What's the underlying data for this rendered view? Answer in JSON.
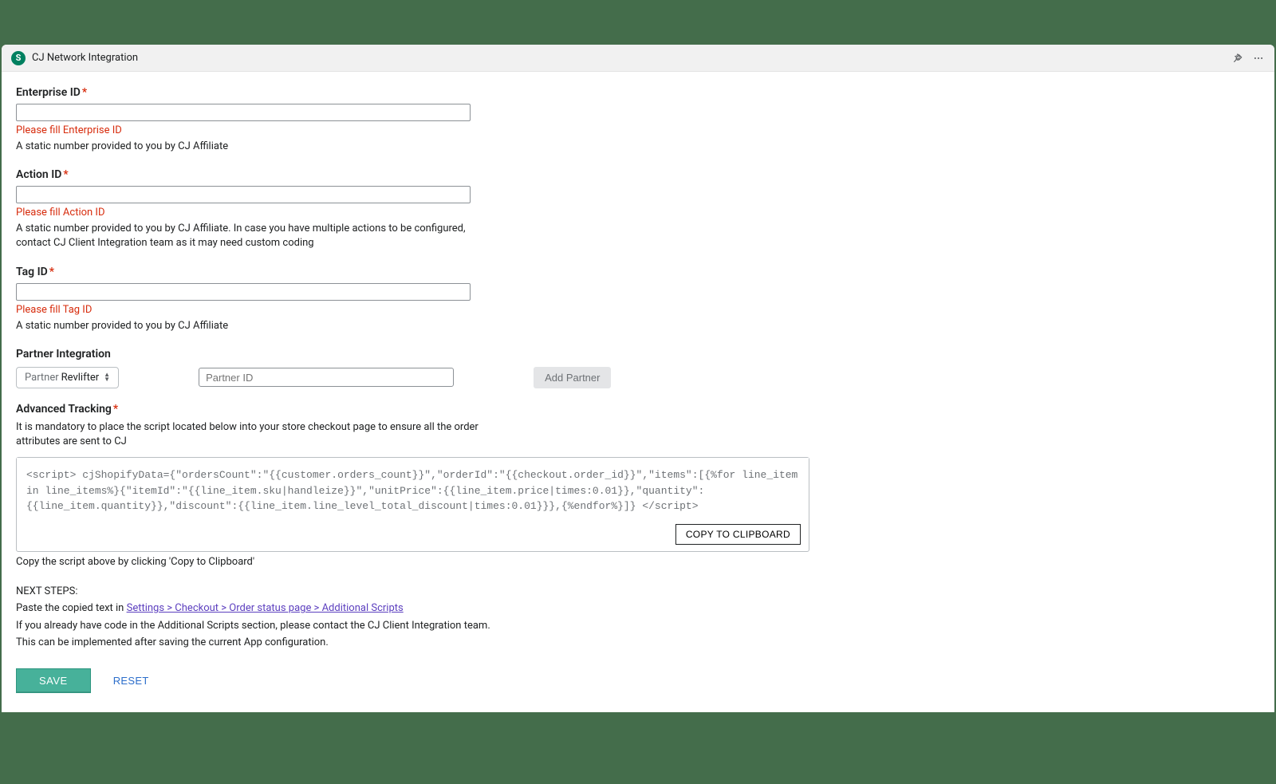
{
  "header": {
    "title": "CJ Network Integration",
    "app_icon_letter": "S"
  },
  "fields": {
    "enterprise": {
      "label": "Enterprise ID",
      "error": "Please fill Enterprise ID",
      "helper": "A static number provided to you by CJ Affiliate"
    },
    "action": {
      "label": "Action ID",
      "error": "Please fill Action ID",
      "helper": "A static number provided to you by CJ Affiliate. In case you have multiple actions to be configured, contact CJ Client Integration team as it may need custom coding"
    },
    "tag": {
      "label": "Tag ID",
      "error": "Please fill Tag ID",
      "helper": "A static number provided to you by CJ Affiliate"
    }
  },
  "partner": {
    "section_label": "Partner Integration",
    "select_label": "Partner",
    "select_value": "Revlifter",
    "id_placeholder": "Partner ID",
    "add_button": "Add Partner"
  },
  "advanced": {
    "label": "Advanced Tracking",
    "helper": "It is mandatory to place the script located below into your store checkout page to ensure all the order attributes are sent to CJ",
    "script": "<script> cjShopifyData={\"ordersCount\":\"{{customer.orders_count}}\",\"orderId\":\"{{checkout.order_id}}\",\"items\":[{%for line_item in line_items%}{\"itemId\":\"{{line_item.sku|handleize}}\",\"unitPrice\":{{line_item.price|times:0.01}},\"quantity\":{{line_item.quantity}},\"discount\":{{line_item.line_level_total_discount|times:0.01}}},{%endfor%}]} </script>",
    "copy_button": "COPY TO CLIPBOARD",
    "copy_helper": "Copy the script above by clicking 'Copy to Clipboard'"
  },
  "next_steps": {
    "heading": "NEXT STEPS:",
    "line1_prefix": "Paste the copied text in ",
    "link": "Settings > Checkout > Order status page > Additional Scripts",
    "line2": "If you already have code in the Additional Scripts section, please contact the CJ Client Integration team.",
    "line3": "This can be implemented after saving the current App configuration."
  },
  "buttons": {
    "save": "SAVE",
    "reset": "RESET"
  }
}
